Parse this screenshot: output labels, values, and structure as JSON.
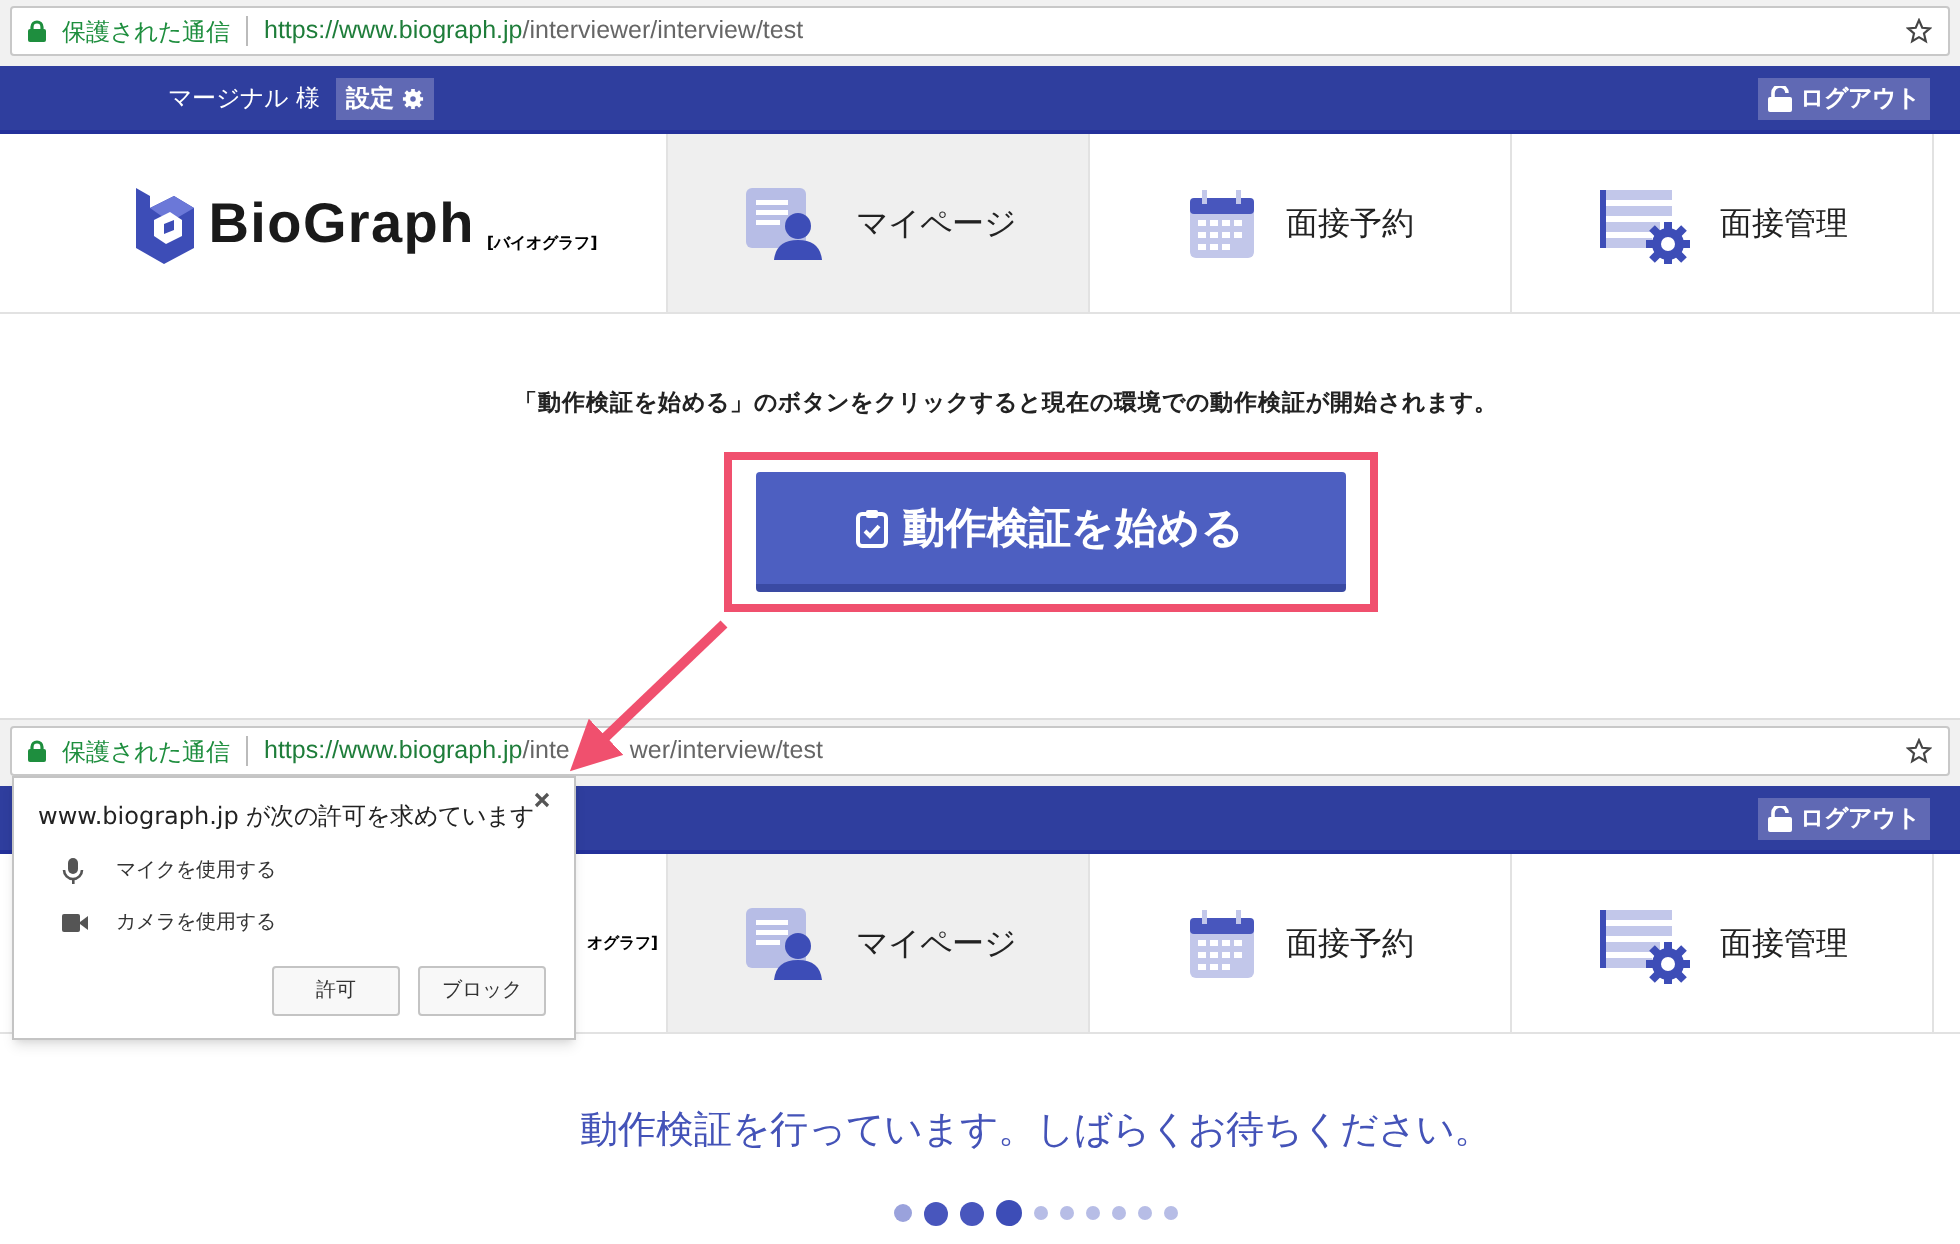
{
  "screens": [
    {
      "address_bar": {
        "security_label": "保護された通信",
        "url_host": "https://www.biograph.jp",
        "url_path": "/interviewer/interview/test"
      },
      "header": {
        "user": "マージナル 様",
        "settings_button": "設定",
        "logout_button": "ログアウト"
      },
      "logo": {
        "name": "BioGraph",
        "reading": "[バイオグラフ]"
      },
      "nav": [
        {
          "kind": "mypage",
          "label": "マイページ",
          "selected": true
        },
        {
          "kind": "calendar",
          "label": "面接予約",
          "selected": false
        },
        {
          "kind": "manage",
          "label": "面接管理",
          "selected": false
        }
      ],
      "content": {
        "kind": "start",
        "instruction": "「動作検証を始める」のボタンをクリックすると現在の環境での動作検証が開始されます。",
        "start_button": "動作検証を始める",
        "highlighted": true
      }
    },
    {
      "address_bar": {
        "security_label": "保護された通信",
        "url_host": "https://www.biograph.jp",
        "url_path": "/inte",
        "url_path_after_arrow": "wer/interview/test"
      },
      "header": {
        "logout_button": "ログアウト"
      },
      "logo": {
        "reading": "オグラフ]"
      },
      "nav": [
        {
          "kind": "mypage",
          "label": "マイページ",
          "selected": true
        },
        {
          "kind": "calendar",
          "label": "面接予約",
          "selected": false
        },
        {
          "kind": "manage",
          "label": "面接管理",
          "selected": false
        }
      ],
      "content": {
        "kind": "progress",
        "message": "動作検証を行っています。しばらくお待ちください。",
        "dots": [
          {
            "kind": "medium"
          },
          {
            "kind": "large"
          },
          {
            "kind": "large"
          },
          {
            "kind": "largest"
          },
          {
            "kind": "small"
          },
          {
            "kind": "small"
          },
          {
            "kind": "small"
          },
          {
            "kind": "small"
          },
          {
            "kind": "small"
          },
          {
            "kind": "small"
          }
        ]
      }
    }
  ],
  "permission_popup": {
    "title": "www.biograph.jp が次の許可を求めています",
    "permissions": [
      {
        "kind": "mic",
        "label": "マイクを使用する"
      },
      {
        "kind": "camera",
        "label": "カメラを使用する"
      }
    ],
    "buttons": [
      "許可",
      "ブロック"
    ]
  }
}
